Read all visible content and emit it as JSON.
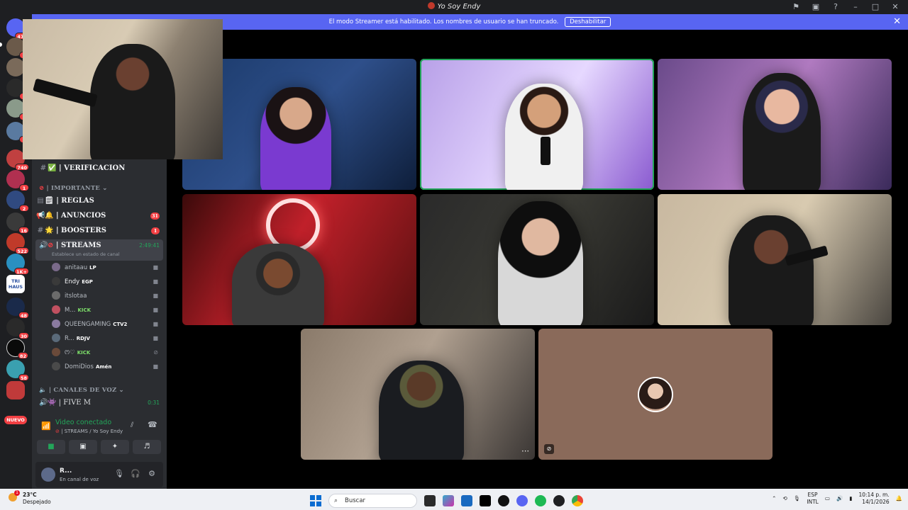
{
  "window": {
    "title": "Yo Soy Endy",
    "controls": [
      "⚑",
      "▣",
      "?",
      "–",
      "□",
      "✕"
    ]
  },
  "banner": {
    "text": "El modo Streamer está habilitado. Los nombres de usuario se han truncado.",
    "button": "Deshabilitar",
    "close": "✕"
  },
  "servers": [
    {
      "badge": "475"
    },
    {
      "badge": "2"
    },
    {
      "badge": ""
    },
    {
      "badge": "1"
    },
    {
      "badge": "1"
    },
    {
      "badge": "1"
    },
    {
      "badge": "740"
    },
    {
      "badge": "1"
    },
    {
      "badge": "2"
    },
    {
      "badge": "16"
    },
    {
      "badge": "522"
    },
    {
      "badge": "1K+"
    },
    {
      "badge": ""
    },
    {
      "badge": "48"
    },
    {
      "badge": "30"
    },
    {
      "badge": "82"
    },
    {
      "badge": "58"
    },
    {
      "badge": ""
    }
  ],
  "server_rail": {
    "tri_haus": "TRI HAUS",
    "nuevo": "NUEVO"
  },
  "sidebar": {
    "verificacion": "| VERIFICACION",
    "importante_category": "| IMPORTANTE",
    "reglas": "| REGLAS",
    "anuncios": "| ANUNCIOS",
    "anuncios_badge": "31",
    "boosters": "| BOOSTERS",
    "boosters_badge": "1",
    "streams": "| STREAMS",
    "streams_timer": "2:49:41",
    "streams_status": "Establece un estado de canal",
    "canales_category": "| CANALES DE VOZ",
    "five_m": "| FIVE M",
    "five_m_timer": "0:31"
  },
  "members": [
    {
      "name": "anitaau",
      "tag": "LP",
      "color": "#7a6a8a"
    },
    {
      "name": "Endy",
      "tag": "EGP",
      "color": "#3a3a3a"
    },
    {
      "name": "itslotaa",
      "tag": "",
      "color": "#6b6b6b"
    },
    {
      "name": "M...",
      "tag": "KICK",
      "color": "#c05060"
    },
    {
      "name": "QUEENGAMING",
      "tag": "CTV2",
      "color": "#8a7aa0"
    },
    {
      "name": "R...",
      "tag": "RDJV",
      "color": "#5a6a7a"
    },
    {
      "name": "ꯁ♡",
      "tag": "KICK",
      "color": "#6a4a3a"
    },
    {
      "name": "DomiDios",
      "tag": "Amén",
      "color": "#4a4a4a"
    }
  ],
  "voice": {
    "status": "Video conectado",
    "channel": "| STREAMS / Yo Soy Endy"
  },
  "user": {
    "name": "R...",
    "status": "En canal de voz"
  },
  "taskbar": {
    "temp": "23°C",
    "weather": "Despejado",
    "alert": "1",
    "search_placeholder": "Buscar",
    "lang1": "ESP",
    "lang2": "INTL",
    "time": "10:14 p. m.",
    "date": "14/1/2026"
  },
  "colors": {
    "accent": "#5865f2",
    "speaking": "#23a55a",
    "badge": "#f23f43",
    "sidebar": "#2b2d31"
  }
}
